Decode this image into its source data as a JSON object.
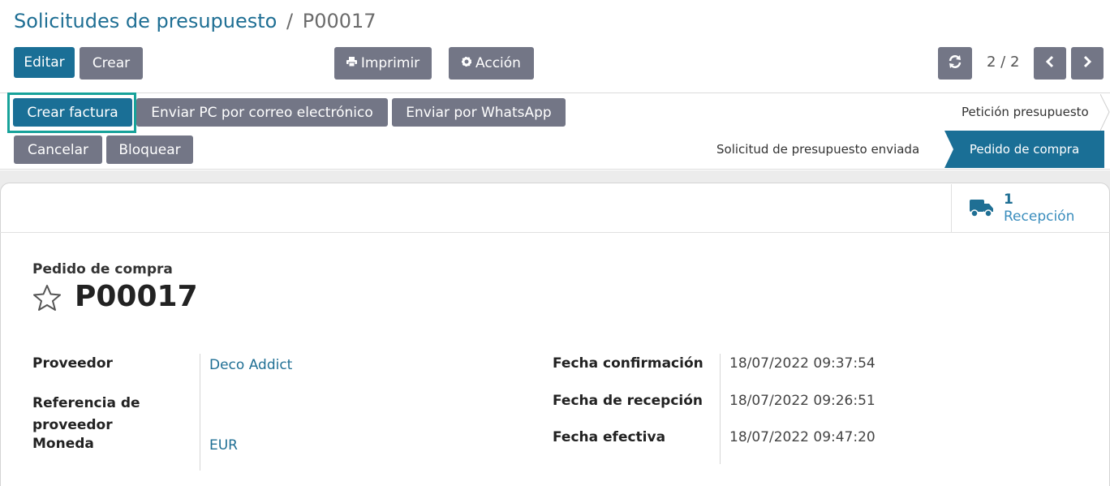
{
  "breadcrumb": {
    "parent": "Solicitudes de presupuesto",
    "separator": "/",
    "current": "P00017"
  },
  "toolbar": {
    "edit_label": "Editar",
    "create_label": "Crear",
    "print_label": "Imprimir",
    "action_label": "Acción"
  },
  "pager": {
    "value": "2 / 2"
  },
  "statusbar": {
    "buttons": [
      "Crear factura",
      "Enviar PC por correo electrónico",
      "Enviar por WhatsApp",
      "Cancelar",
      "Bloquear"
    ],
    "stages": [
      "Petición presupuesto",
      "Solicitud de presupuesto enviada",
      "Pedido de compra"
    ],
    "active_stage": "Pedido de compra"
  },
  "smart_button": {
    "icon": "truck-icon",
    "value": "1",
    "label": "Recepción"
  },
  "document": {
    "label": "Pedido de compra",
    "name": "P00017"
  },
  "fields_left": [
    {
      "label": "Proveedor",
      "value": "Deco Addict"
    },
    {
      "label": "Referencia de proveedor",
      "value": ""
    },
    {
      "label": "Moneda",
      "value": "EUR"
    }
  ],
  "fields_right": [
    {
      "label": "Fecha confirmación",
      "value": "18/07/2022 09:37:54"
    },
    {
      "label": "Fecha de recepción",
      "value": "18/07/2022 09:26:51"
    },
    {
      "label": "Fecha efectiva",
      "value": "18/07/2022 09:47:20"
    }
  ],
  "colors": {
    "primary": "#1a6f96",
    "secondary": "#737686",
    "highlight": "#17a29a"
  }
}
